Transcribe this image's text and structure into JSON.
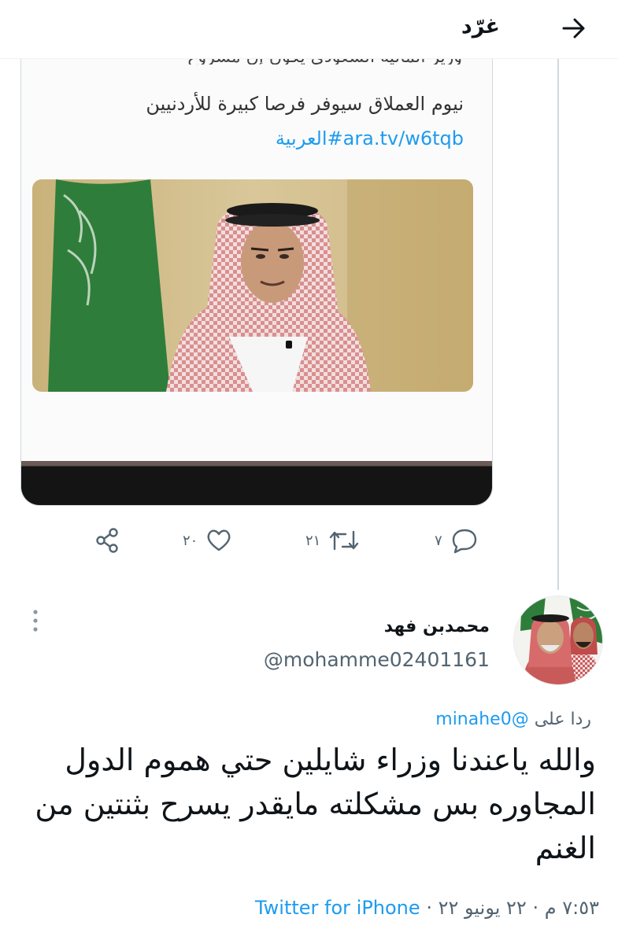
{
  "header": {
    "title": "غرّد"
  },
  "embedded_card": {
    "cut_text": "وزير المالية السعودي يكون إن مشروع",
    "line1": "نيوم العملاق سيوفر فرصا كبيرة للأردنيين",
    "line2": "ara.tv/w6tqb#العربية"
  },
  "actions": {
    "replies": "٧",
    "retweets": "٢١",
    "likes": "٢٠"
  },
  "reply_tweet": {
    "display_name": "محمدبن فهد",
    "handle": "@mohamme02401161",
    "replying_prefix": "ردا على",
    "replying_to": "@minahe0",
    "text": "والله ياعندنا وزراء شايلين حتي هموم الدول المجاوره بس مشكلته مايقدر يسرح بثنتين من الغنم",
    "time": "٧:٥٣ م",
    "date": "٢٢ يونيو ٢٢",
    "source": "Twitter for iPhone",
    "separator": "·"
  },
  "colors": {
    "accent": "#1d9bf0",
    "secondary_text": "#536471",
    "flag_green": "#2f7d3a"
  }
}
